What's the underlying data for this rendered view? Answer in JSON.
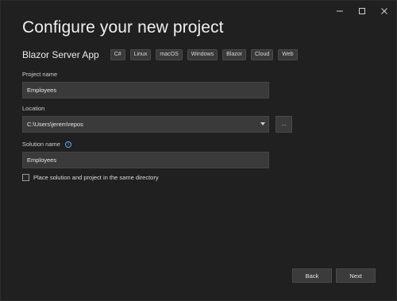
{
  "window": {
    "title": "Configure your new project",
    "controls": [
      "minimize-icon",
      "maximize-icon",
      "close-icon"
    ]
  },
  "template": {
    "name": "Blazor Server App",
    "tags": [
      "C#",
      "Linux",
      "macOS",
      "Windows",
      "Blazor",
      "Cloud",
      "Web"
    ]
  },
  "project_name": {
    "label": "Project name",
    "value": "Employees"
  },
  "location": {
    "label": "Location",
    "value": "C:\\Users\\jerem\\repos",
    "browse_label": "..."
  },
  "solution_name": {
    "label": "Solution name",
    "info_icon": "info-icon",
    "value": "Employees"
  },
  "same_directory": {
    "label": "Place solution and project in the same directory",
    "checked": false
  },
  "footer": {
    "back_label": "Back",
    "next_label": "Next"
  },
  "colors": {
    "background": "#202020",
    "field": "#3a3a3a",
    "accent": "#6aa8f0"
  }
}
